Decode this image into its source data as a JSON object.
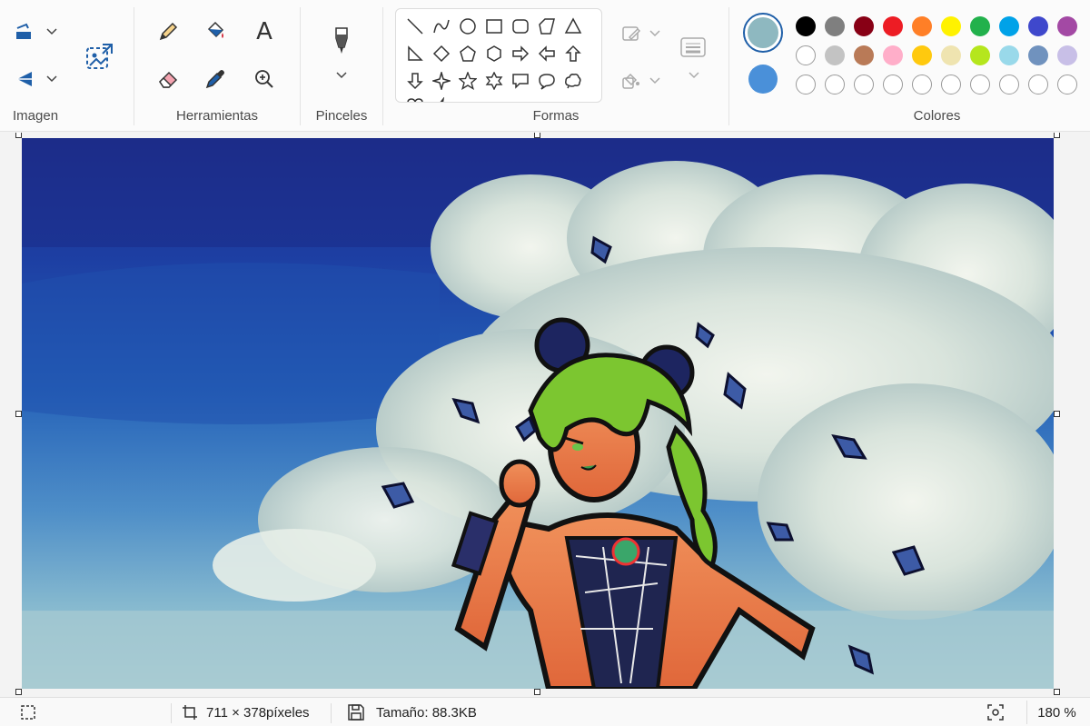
{
  "ribbon": {
    "groups": {
      "image": "Imagen",
      "tools": "Herramientas",
      "brushes": "Pinceles",
      "shapes": "Formas",
      "colors": "Colores"
    },
    "tools": {
      "text_glyph": "A"
    }
  },
  "colors": {
    "current": "#8eb8c0",
    "secondary": "#4a90d9",
    "palette_row1": [
      "#000000",
      "#7f7f7f",
      "#880015",
      "#ed1c24",
      "#ff7f27",
      "#fff200",
      "#22b14c",
      "#00a2e8",
      "#3f48cc",
      "#a349a4"
    ],
    "palette_row2": [
      "#ffffff",
      "#c3c3c3",
      "#b97a57",
      "#ffaec9",
      "#ffc90e",
      "#efe4b0",
      "#b5e61d",
      "#99d9ea",
      "#7092be",
      "#c8bfe7"
    ],
    "palette_row3_count": 10
  },
  "statusbar": {
    "dimensions": "711 × 378píxeles",
    "size": "Tamaño: 88.3KB",
    "zoom": "180 %"
  }
}
